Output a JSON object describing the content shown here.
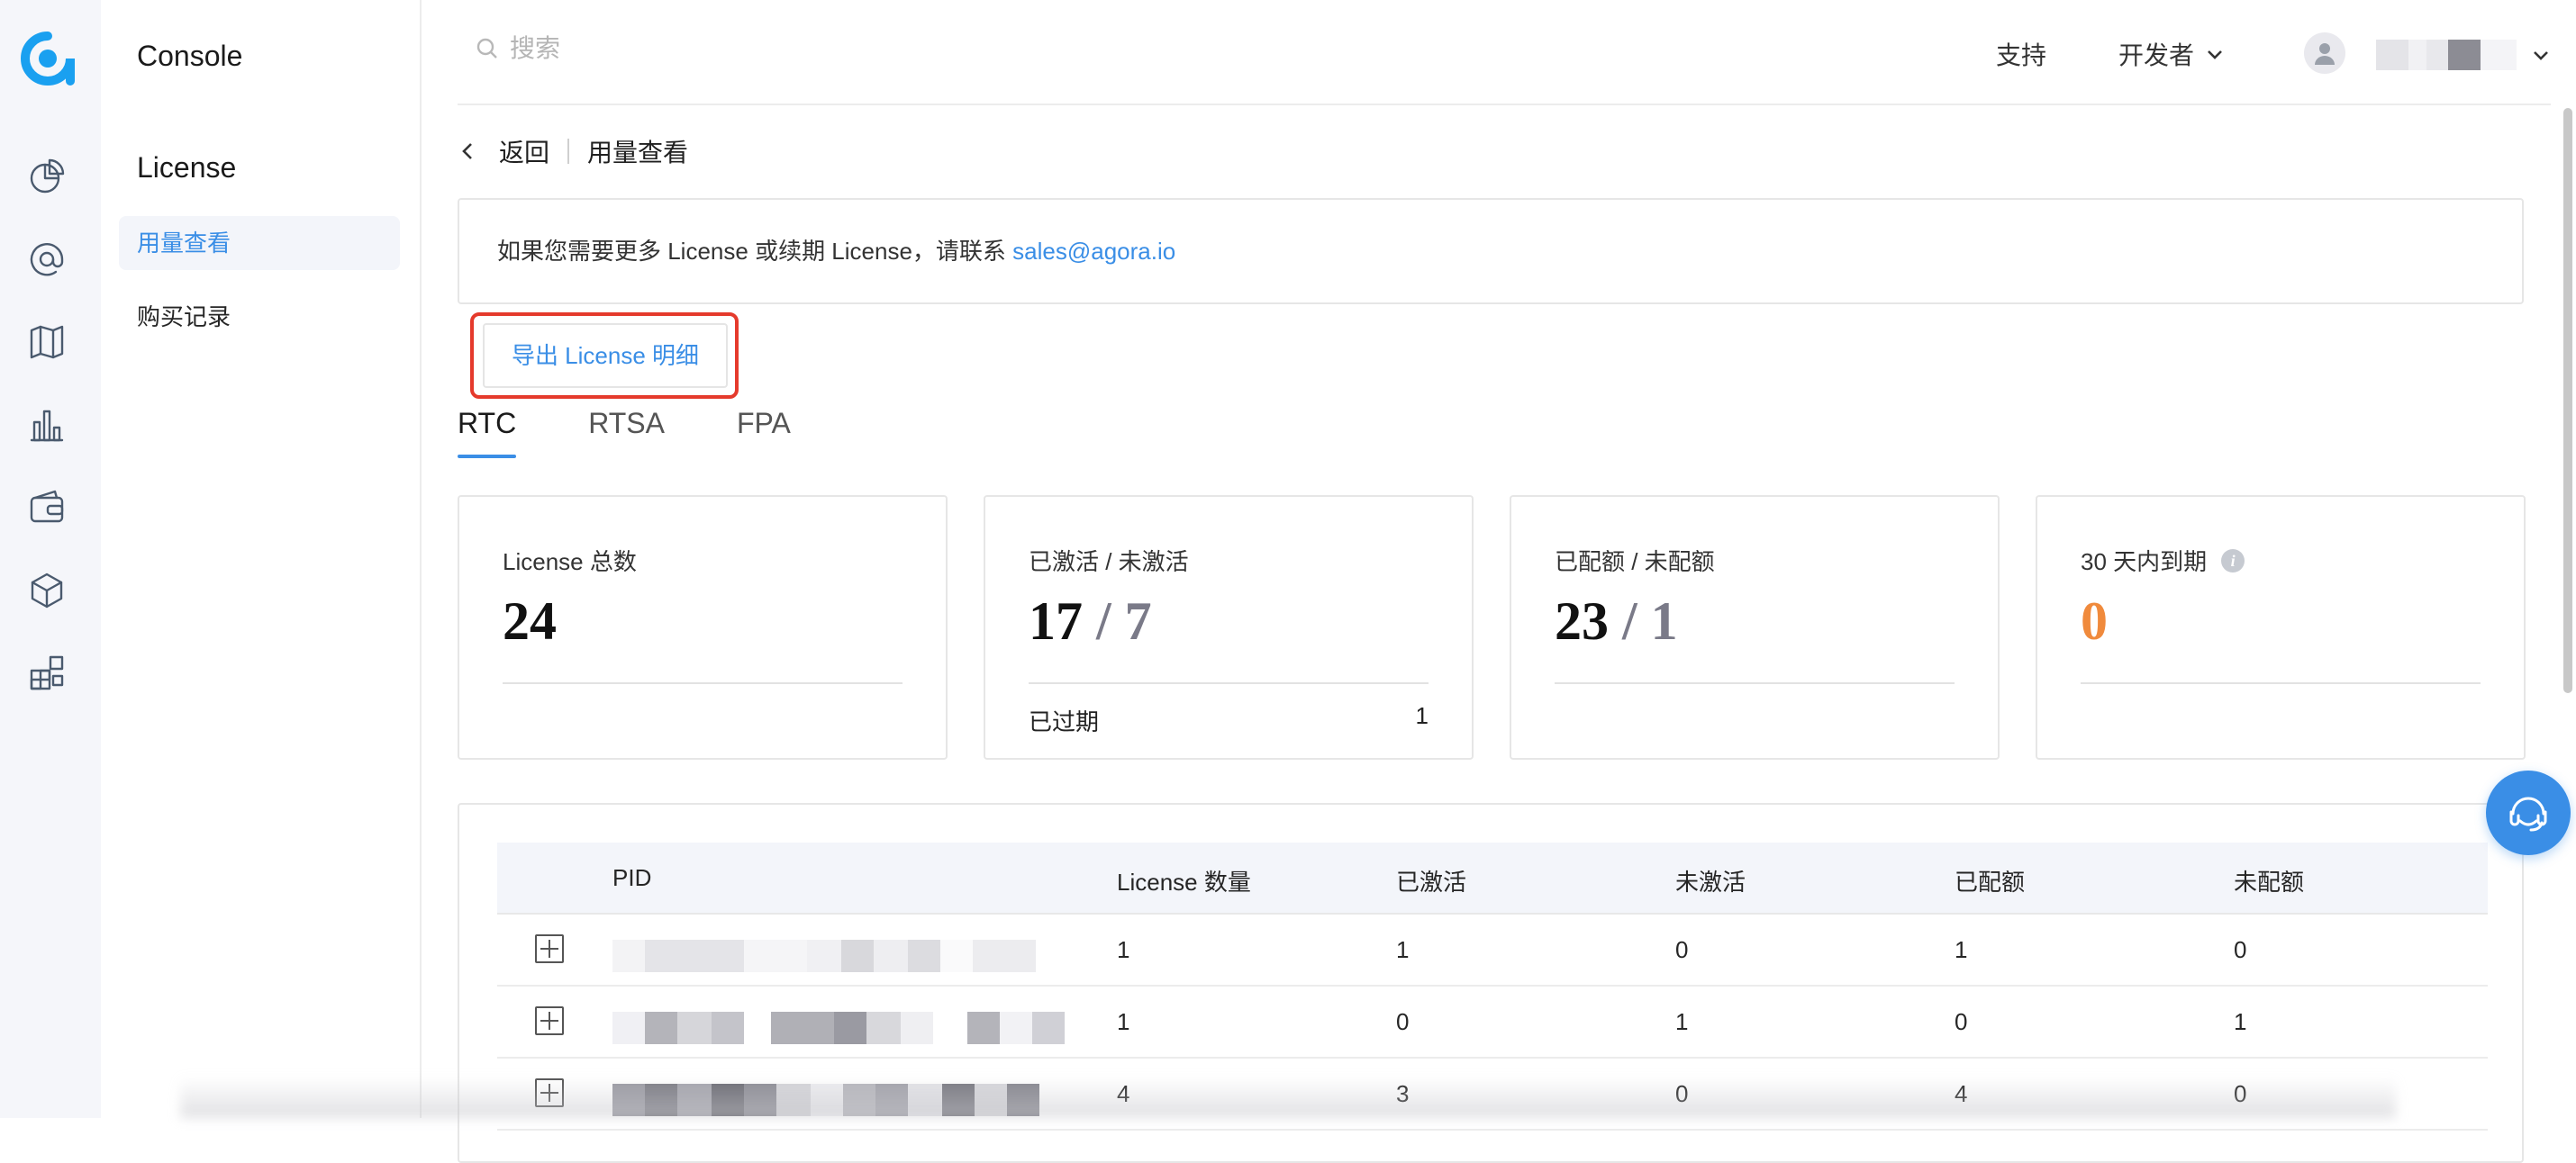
{
  "app": {
    "name": "Console"
  },
  "sidebar": {
    "section_title": "License",
    "items": [
      {
        "label": "用量查看",
        "active": true
      },
      {
        "label": "购买记录",
        "active": false
      }
    ]
  },
  "rail_icons": [
    "pie-chart-icon",
    "at-sign-icon",
    "map-icon",
    "bar-chart-icon",
    "wallet-icon",
    "cube-icon",
    "widgets-icon"
  ],
  "topbar": {
    "search_placeholder": "搜索",
    "support": "支持",
    "developer": "开发者"
  },
  "breadcrumb": {
    "back": "返回",
    "current": "用量查看"
  },
  "notice": {
    "text": "如果您需要更多 License 或续期 License，请联系 ",
    "email": "sales@agora.io"
  },
  "export_button": "导出 License 明细",
  "tabs": [
    {
      "label": "RTC",
      "active": true
    },
    {
      "label": "RTSA",
      "active": false
    },
    {
      "label": "FPA",
      "active": false
    }
  ],
  "cards": {
    "total": {
      "label": "License 总数",
      "value": "24"
    },
    "activation": {
      "label": "已激活 / 未激活",
      "primary": "17",
      "slash": " / ",
      "secondary": "7",
      "sub_label": "已过期",
      "sub_value": "1"
    },
    "quota": {
      "label": "已配额 / 未配额",
      "primary": "23",
      "slash": " / ",
      "secondary": "1"
    },
    "expiring": {
      "label": "30 天内到期",
      "value": "0"
    }
  },
  "table": {
    "columns": [
      "PID",
      "License 数量",
      "已激活",
      "未激活",
      "已配额",
      "未配额"
    ],
    "rows": [
      {
        "count": "1",
        "activated": "1",
        "inactive": "0",
        "quota": "1",
        "unquota": "0"
      },
      {
        "count": "1",
        "activated": "0",
        "inactive": "1",
        "quota": "0",
        "unquota": "1"
      },
      {
        "count": "4",
        "activated": "3",
        "inactive": "0",
        "quota": "4",
        "unquota": "0"
      }
    ]
  },
  "colors": {
    "accent": "#3a8ee6",
    "highlight": "#e53a2c",
    "warning": "#f08a3c"
  }
}
